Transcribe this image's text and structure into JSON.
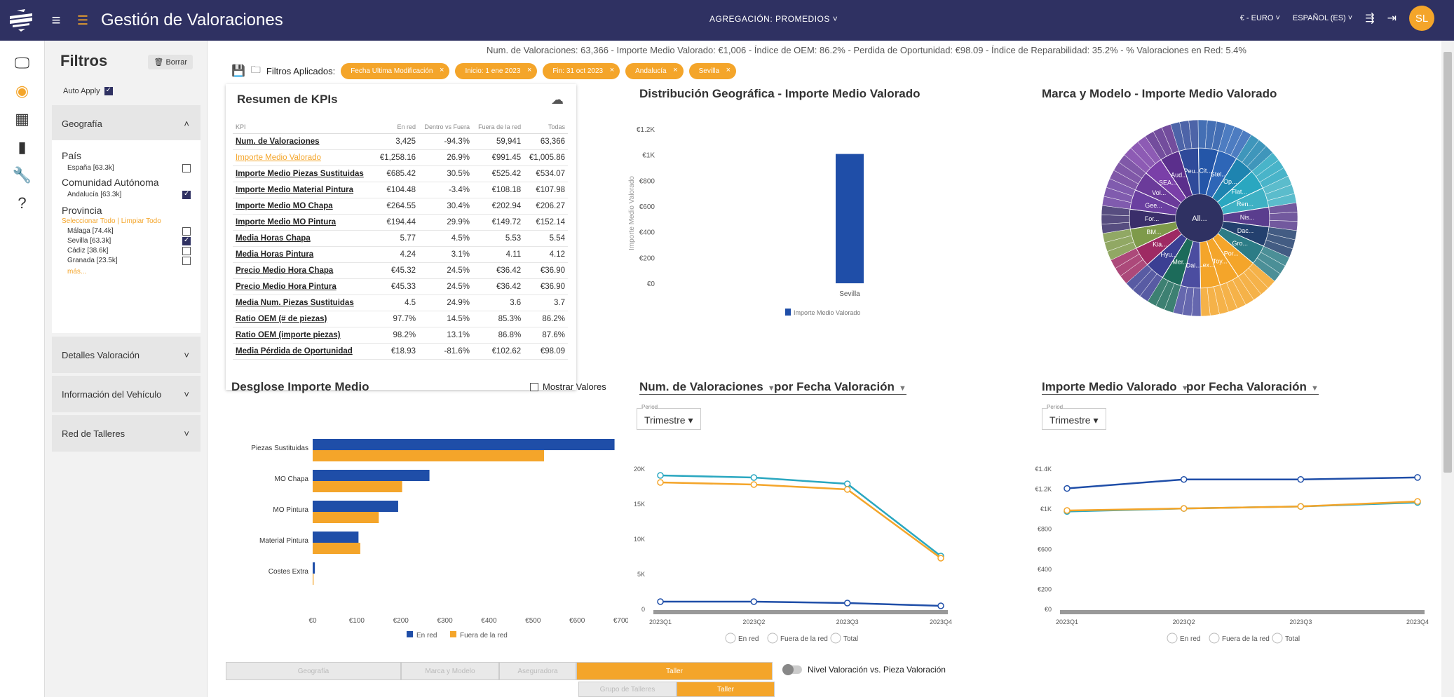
{
  "app": {
    "title": "Gestión de Valoraciones",
    "aggregation_label": "AGREGACIÓN:",
    "aggregation_value": "PROMEDIOS",
    "currency": "€ - EURO",
    "language": "ESPAÑOL (ES)",
    "avatar": "SL"
  },
  "colors": {
    "navy": "#2f3162",
    "orange": "#f4a52a",
    "blue": "#1f4ea8",
    "teal": "#2aa7c0"
  },
  "filters": {
    "title": "Filtros",
    "clear_label": "Borrar",
    "auto_apply_label": "Auto Apply",
    "geografia": {
      "label": "Geografía",
      "pais_label": "País",
      "pais_items": [
        {
          "label": "España [63.3k]",
          "checked": false
        }
      ],
      "ccaa_label": "Comunidad Autónoma",
      "ccaa_items": [
        {
          "label": "Andalucía [63.3k]",
          "checked": true
        }
      ],
      "provincia_label": "Provincia",
      "select_all": "Seleccionar Todo",
      "clear_all": "Limpiar Todo",
      "provincia_items": [
        {
          "label": "Málaga [74.4k]",
          "checked": false
        },
        {
          "label": "Sevilla [63.3k]",
          "checked": true
        },
        {
          "label": "Cádiz [38.6k]",
          "checked": false
        },
        {
          "label": "Granada [23.5k]",
          "checked": false
        }
      ],
      "more": "más..."
    },
    "sections": [
      "Detalles Valoración",
      "Información del Vehículo",
      "Red de Talleres"
    ]
  },
  "summary": "Num. de Valoraciones: 63,366  -  Importe Medio Valorado: €1,006  -  Índice de OEM: 86.2%  -  Perdida de Oportunidad: €98.09  -  Índice de Reparabilidad: 35.2%  -  % Valoraciones en Red: 5.4%",
  "applied": {
    "label": "Filtros Aplicados:",
    "chips": [
      "Fecha Ultima Modificación",
      "Inicio: 1 ene 2023",
      "Fin: 31 oct 2023",
      "Andalucía",
      "Sevilla"
    ]
  },
  "kpi": {
    "title": "Resumen de KPIs",
    "headers": [
      "KPI",
      "En red",
      "Dentro vs Fuera",
      "Fuera de la red",
      "Todas"
    ],
    "rows": [
      [
        "Num. de Valoraciones",
        "3,425",
        "-94.3%",
        "59,941",
        "63,366"
      ],
      [
        "Importe Medio Valorado",
        "€1,258.16",
        "26.9%",
        "€991.45",
        "€1,005.86"
      ],
      [
        "Importe Medio Piezas Sustituidas",
        "€685.42",
        "30.5%",
        "€525.42",
        "€534.07"
      ],
      [
        "Importe Medio Material Pintura",
        "€104.48",
        "-3.4%",
        "€108.18",
        "€107.98"
      ],
      [
        "Importe Medio MO Chapa",
        "€264.55",
        "30.4%",
        "€202.94",
        "€206.27"
      ],
      [
        "Importe Medio MO Pintura",
        "€194.44",
        "29.9%",
        "€149.72",
        "€152.14"
      ],
      [
        "Media Horas Chapa",
        "5.77",
        "4.5%",
        "5.53",
        "5.54"
      ],
      [
        "Media Horas Pintura",
        "4.24",
        "3.1%",
        "4.11",
        "4.12"
      ],
      [
        "Precio Medio Hora Chapa",
        "€45.32",
        "24.5%",
        "€36.42",
        "€36.90"
      ],
      [
        "Precio Medio Hora Pintura",
        "€45.33",
        "24.5%",
        "€36.42",
        "€36.90"
      ],
      [
        "Media Num. Piezas Sustituidas",
        "4.5",
        "24.9%",
        "3.6",
        "3.7"
      ],
      [
        "Ratio OEM (# de piezas)",
        "97.7%",
        "14.5%",
        "85.3%",
        "86.2%"
      ],
      [
        "Ratio OEM (importe piezas)",
        "98.2%",
        "13.1%",
        "86.8%",
        "87.6%"
      ],
      [
        "Media Pérdida de Oportunidad",
        "€18.93",
        "-81.6%",
        "€102.62",
        "€98.09"
      ]
    ]
  },
  "geo_title": "Distribución Geográfica - Importe Medio Valorado",
  "brand_title": "Marca y Modelo - Importe Medio Valorado",
  "desglose": {
    "title": "Desglose Importe Medio",
    "show_values": "Mostrar Valores"
  },
  "num_line": {
    "metric": "Num. de Valoraciones",
    "by": "por Fecha Valoración",
    "period_label": "Period",
    "period": "Trimestre"
  },
  "imp_line": {
    "metric": "Importe Medio Valorado",
    "by": "por Fecha Valoración",
    "period_label": "Period",
    "period": "Trimestre"
  },
  "tabs": [
    "Geografía",
    "Marca y Modelo",
    "Aseguradora",
    "Taller"
  ],
  "subtabs": [
    "Grupo de Talleres",
    "Taller"
  ],
  "toggle_label": "Nivel Valoración vs. Pieza Valoración",
  "chart_data": [
    {
      "type": "bar",
      "title": "Distribución Geográfica - Importe Medio Valorado",
      "categories": [
        "Sevilla"
      ],
      "values": [
        1006
      ],
      "ylabel": "Importe Medio Valorado",
      "ylim": [
        0,
        1200
      ],
      "yticks": [
        "€0",
        "€200",
        "€400",
        "€600",
        "€800",
        "€1K",
        "€1.2K"
      ],
      "legend": "Importe Medio Valorado"
    },
    {
      "type": "pie",
      "title": "Marca y Modelo - Importe Medio Valorado",
      "center_label": "All...",
      "labels": [
        "Peu...",
        "Cit...",
        "Stel...",
        "Op...",
        "Flat...",
        "Ren...",
        "Nis...",
        "Dac...",
        "Gro...",
        "Por...",
        "Toy...",
        "Lex...",
        "Dai...",
        "Mer...",
        "Hyu...",
        "Kia...",
        "BM...",
        "For...",
        "Gee...",
        "Vol...",
        "SEA...",
        "Aud..."
      ]
    },
    {
      "type": "bar",
      "title": "Desglose Importe Medio",
      "categories": [
        "Piezas Sustituidas",
        "MO Chapa",
        "MO Pintura",
        "Material Pintura",
        "Costes Extra"
      ],
      "series": [
        {
          "name": "En red",
          "values": [
            685,
            265,
            194,
            104,
            5
          ]
        },
        {
          "name": "Fuera de la red",
          "values": [
            525,
            203,
            150,
            108,
            2
          ]
        }
      ],
      "xticks": [
        "€0",
        "€100",
        "€200",
        "€300",
        "€400",
        "€500",
        "€600",
        "€700"
      ],
      "xlim": [
        0,
        700
      ]
    },
    {
      "type": "line",
      "title": "Num. de Valoraciones por Fecha Valoración",
      "categories": [
        "2023Q1",
        "2023Q2",
        "2023Q3",
        "2023Q4"
      ],
      "series": [
        {
          "name": "En red",
          "values": [
            1000,
            1000,
            800,
            400
          ]
        },
        {
          "name": "Fuera de la red",
          "values": [
            18000,
            17700,
            17000,
            7200
          ]
        },
        {
          "name": "Total",
          "values": [
            19000,
            18700,
            17800,
            7500
          ]
        }
      ],
      "yticks": [
        "0",
        "5K",
        "10K",
        "15K",
        "20K"
      ],
      "ylim": [
        0,
        20000
      ]
    },
    {
      "type": "line",
      "title": "Importe Medio Valorado por Fecha Valoración",
      "categories": [
        "2023Q1",
        "2023Q2",
        "2023Q3",
        "2023Q4"
      ],
      "series": [
        {
          "name": "En red",
          "values": [
            1200,
            1290,
            1290,
            1310
          ]
        },
        {
          "name": "Fuera de la red",
          "values": [
            980,
            1000,
            1020,
            1070
          ]
        },
        {
          "name": "Total",
          "values": [
            970,
            1000,
            1020,
            1060
          ]
        }
      ],
      "yticks": [
        "€0",
        "€200",
        "€400",
        "€600",
        "€800",
        "€1K",
        "€1.2K",
        "€1.4K"
      ],
      "ylim": [
        0,
        1400
      ]
    }
  ]
}
